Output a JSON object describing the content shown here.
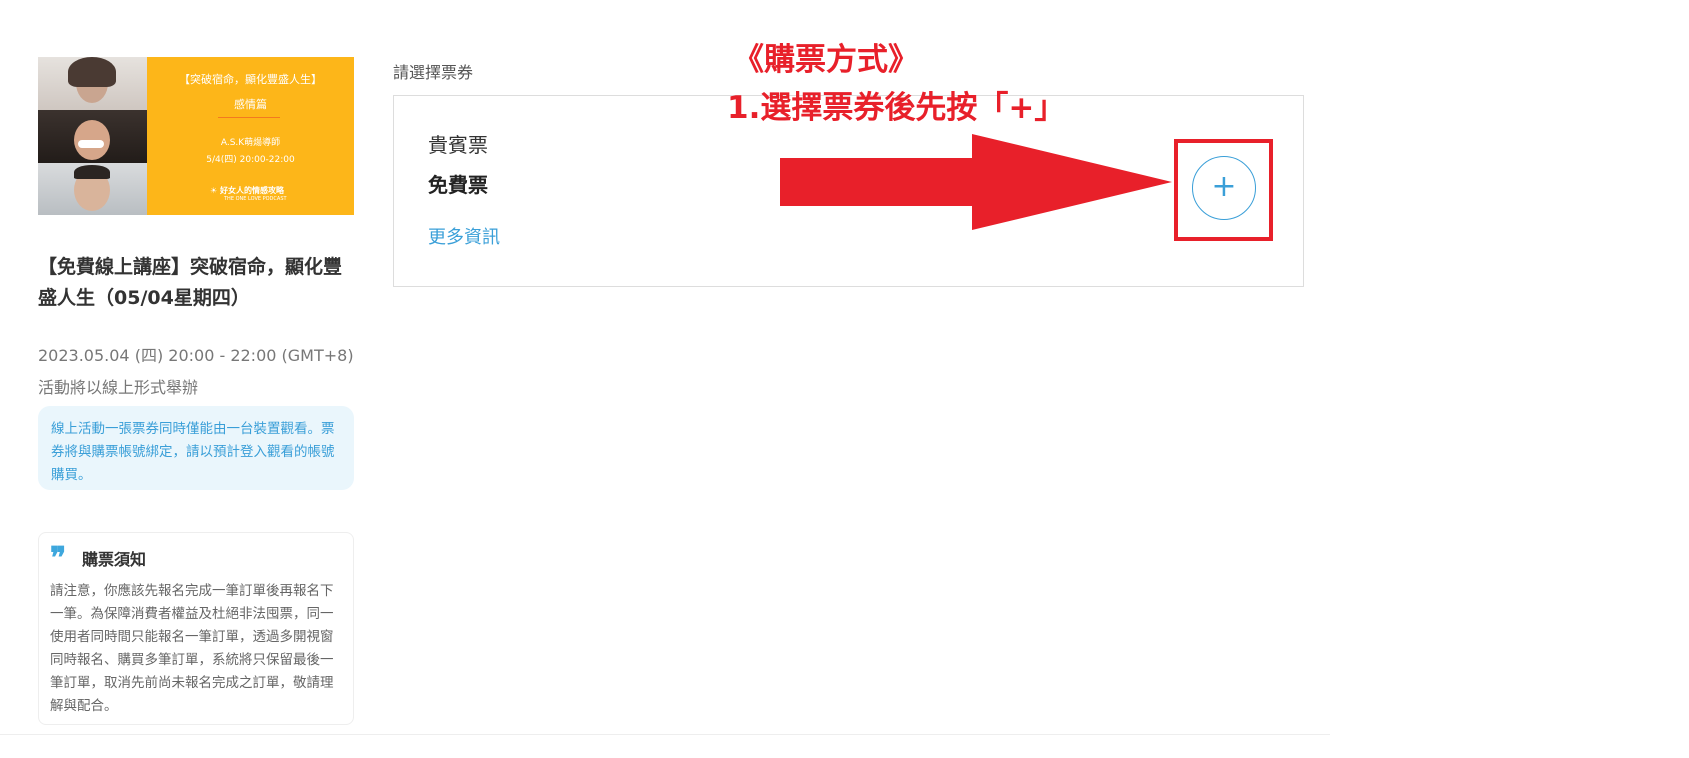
{
  "banner": {
    "title": "【突破宿命，顯化豐盛人生】",
    "subtitle": "感情篇",
    "speaker": "A.S.K萌煬導師",
    "time": "5/4(四) 20:00-22:00",
    "logo_text": "好女人的情感攻略",
    "logo_subtext": "THE ONE LOVE PODCAST"
  },
  "event": {
    "title": "【免費線上講座】突破宿命，顯化豐盛人生（05/04星期四）",
    "date": "2023.05.04 (四) 20:00 - 22:00 (GMT+8)",
    "mode": "活動將以線上形式舉辦",
    "online_note": "線上活動一張票券同時僅能由一台裝置觀看。票券將與購票帳號綁定，請以預計登入觀看的帳號購買。"
  },
  "notice": {
    "title": "購票須知",
    "body": "請注意，你應該先報名完成一筆訂單後再報名下一筆。為保障消費者權益及杜絕非法囤票，同一使用者同時間只能報名一筆訂單，透過多開視窗同時報名、購買多筆訂單，系統將只保留最後一筆訂單，取消先前尚未報名完成之訂單，敬請理解與配合。"
  },
  "tickets": {
    "section_label": "請選擇票券",
    "items": [
      {
        "name": "貴賓票",
        "price": "免費票",
        "more_info": "更多資訊",
        "add_symbol": "+"
      }
    ]
  },
  "annotation": {
    "line1": "《購票方式》",
    "line2": "1.選擇票券後先按「+」",
    "color": "#e8202a"
  },
  "colors": {
    "accent": "#3a9fd8",
    "banner_bg": "#fdb619",
    "annotation_red": "#e8202a"
  }
}
